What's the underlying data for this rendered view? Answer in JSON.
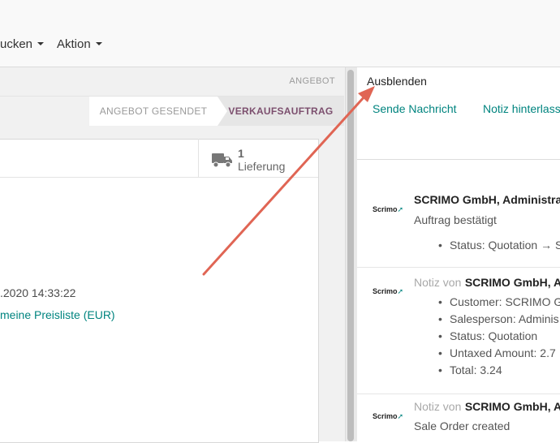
{
  "menus": {
    "print": "ucken",
    "action": "Aktion"
  },
  "status": {
    "quotation": "ANGEBOT",
    "steps": [
      {
        "label": "ANGEBOT GESENDET"
      },
      {
        "label": "VERKAUFSAUFTRAG"
      }
    ]
  },
  "smart_button": {
    "count": "1",
    "label": "Lieferung"
  },
  "form": {
    "date": ".2020 14:33:22",
    "pricelist": "meine Preisliste (EUR)"
  },
  "chatter": {
    "hide": "Ausblenden",
    "send_message": "Sende Nachricht",
    "log_note": "Notiz hinterlass",
    "messages": [
      {
        "author": "SCRIMO GmbH, Administrat",
        "body": "Auftrag bestätigt",
        "bullets": [
          "Status: Quotation → S"
        ]
      },
      {
        "prefix": "Notiz von",
        "author": "SCRIMO GmbH, Ac",
        "bullets": [
          "Customer: SCRIMO G",
          "Salesperson: Adminis",
          "Status: Quotation",
          "Untaxed Amount: 2.7",
          "Total: 3.24"
        ]
      },
      {
        "prefix": "Notiz von",
        "author": "SCRIMO GmbH, Ac",
        "body": "Sale Order created"
      }
    ]
  },
  "avatar_text": "Scrimo",
  "colors": {
    "accent": "#00847f",
    "active_step": "#7c4f6e",
    "arrow": "#e06554"
  }
}
